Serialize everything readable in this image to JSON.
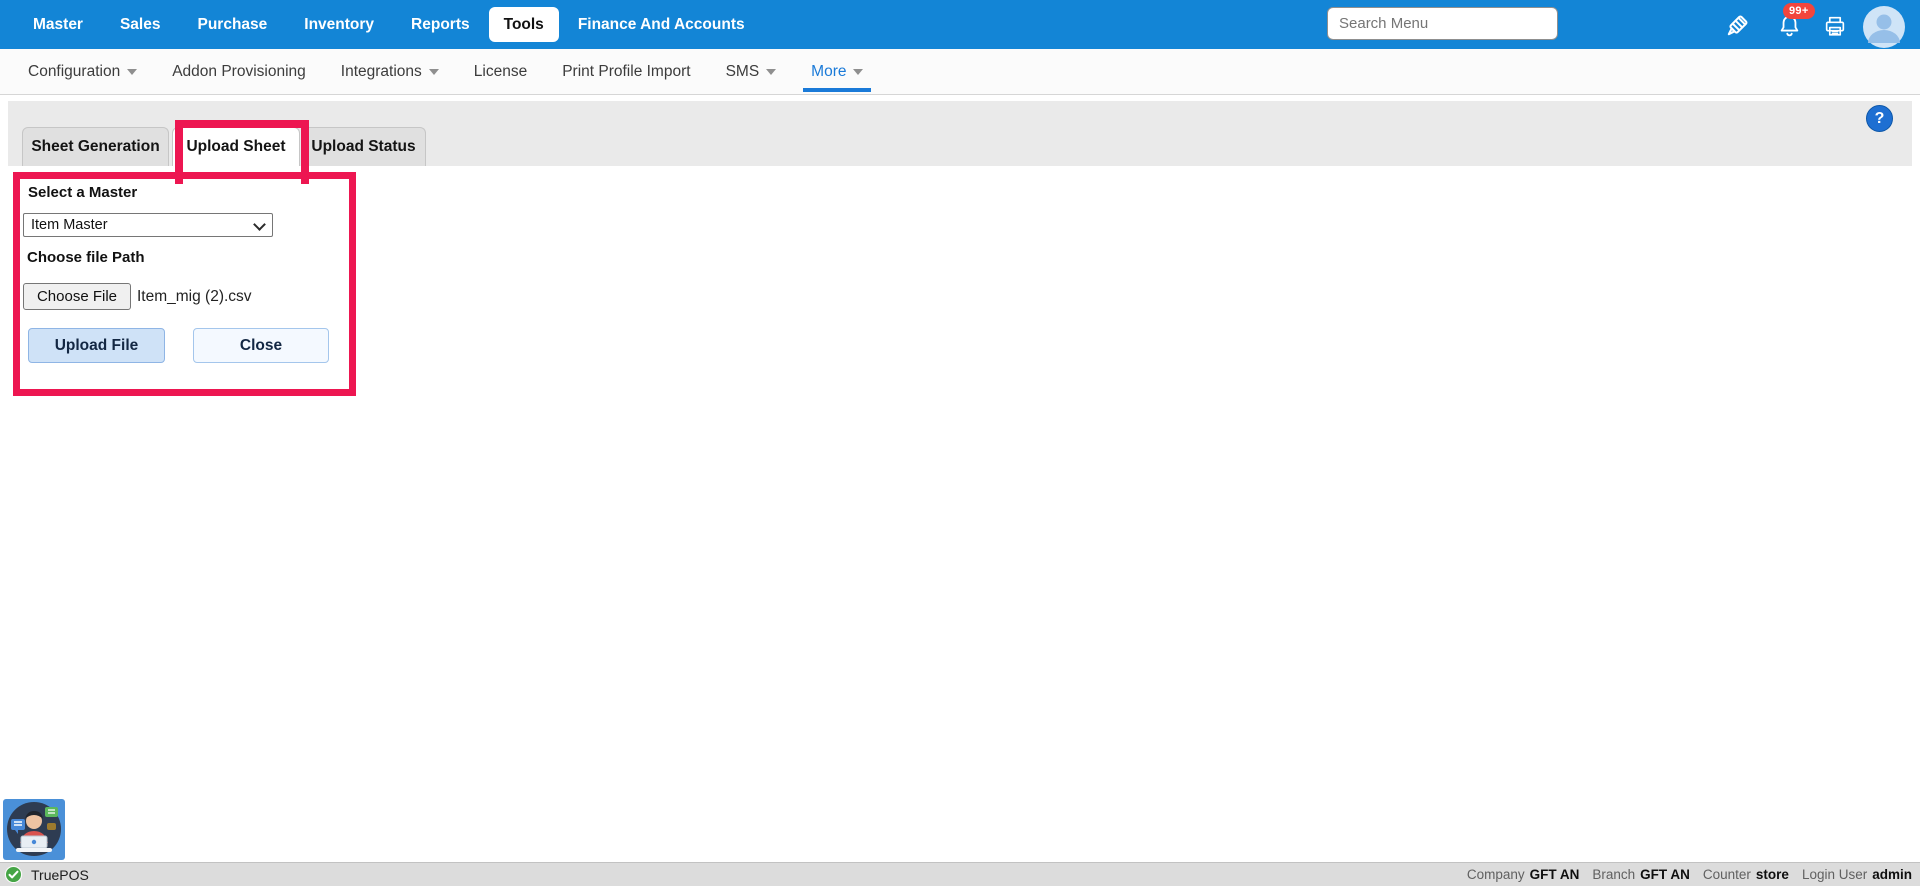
{
  "topbar": {
    "items": [
      "Master",
      "Sales",
      "Purchase",
      "Inventory",
      "Reports",
      "Tools",
      "Finance And Accounts"
    ],
    "active_item": "Tools",
    "search_placeholder": "Search Menu",
    "notification_count": "99+"
  },
  "subnav": {
    "items": [
      {
        "label": "Configuration",
        "dropdown": true
      },
      {
        "label": "Addon Provisioning",
        "dropdown": false
      },
      {
        "label": "Integrations",
        "dropdown": true
      },
      {
        "label": "License",
        "dropdown": false
      },
      {
        "label": "Print Profile Import",
        "dropdown": false
      },
      {
        "label": "SMS",
        "dropdown": true
      },
      {
        "label": "More",
        "dropdown": true
      }
    ],
    "active_item": "More"
  },
  "tabs": {
    "items": [
      {
        "label": "Sheet Generation"
      },
      {
        "label": "Upload Sheet"
      },
      {
        "label": "Upload Status"
      }
    ],
    "active_tab": "Upload Sheet"
  },
  "help_label": "?",
  "form": {
    "select_label": "Select a Master",
    "select_value": "Item Master",
    "file_label": "Choose file Path",
    "choose_file_button": "Choose File",
    "file_name": "Item_mig (2).csv",
    "upload_button": "Upload File",
    "close_button": "Close"
  },
  "statusbar": {
    "app_name": "TruePOS",
    "fields": [
      {
        "label": "Company",
        "value": "GFT AN"
      },
      {
        "label": "Branch",
        "value": "GFT AN"
      },
      {
        "label": "Counter",
        "value": "store"
      },
      {
        "label": "Login User",
        "value": "admin"
      }
    ]
  },
  "colors": {
    "primary_blue": "#1385d6",
    "link_blue": "#1a7ad8",
    "annotation_pink": "#ed1651",
    "notification_red": "#f2453d",
    "upload_button_fill": "#cfe2f7",
    "tab_band_gray": "#eaeaea"
  }
}
